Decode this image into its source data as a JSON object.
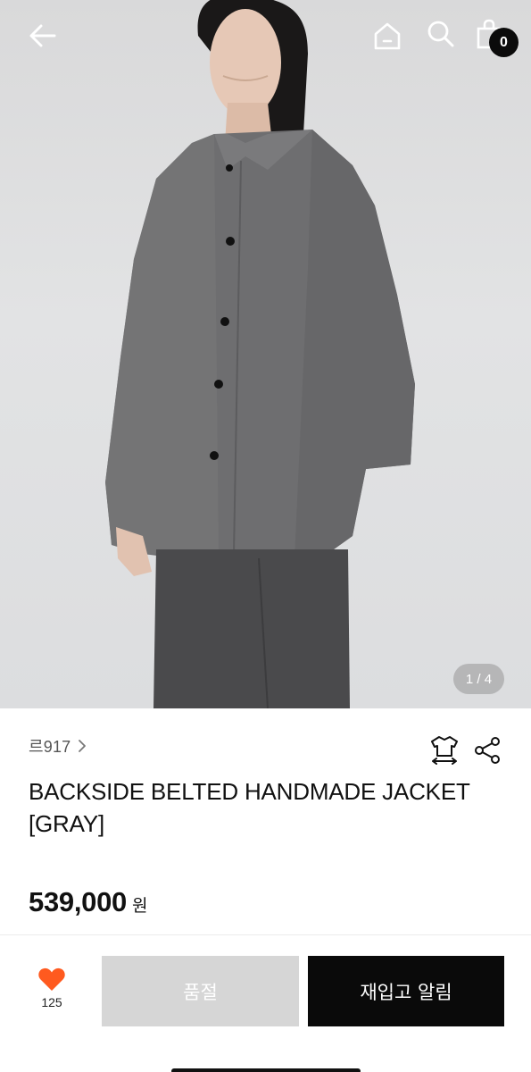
{
  "header": {
    "back_icon": "arrow-left-icon",
    "home_icon": "home-icon",
    "search_icon": "search-icon",
    "cart_icon": "shopping-bag-icon",
    "cart_count": "0"
  },
  "gallery": {
    "pager": "1 / 4",
    "image": "model-wearing-gray-jacket"
  },
  "product": {
    "brand": "르917",
    "brand_chevron_icon": "chevron-right-icon",
    "size_icon": "size-guide-shirt-icon",
    "share_icon": "share-icon",
    "title": "BACKSIDE BELTED HANDMADE JACKET [GRAY]",
    "price": "539,000",
    "currency": "원"
  },
  "actions": {
    "like_icon": "heart-icon",
    "like_count": "125",
    "soldout_label": "품절",
    "restock_label": "재입고 알림"
  },
  "colors": {
    "heart": "#ff5a1f",
    "soldout_bg": "#d6d6d6",
    "restock_bg": "#0a0a0a"
  }
}
